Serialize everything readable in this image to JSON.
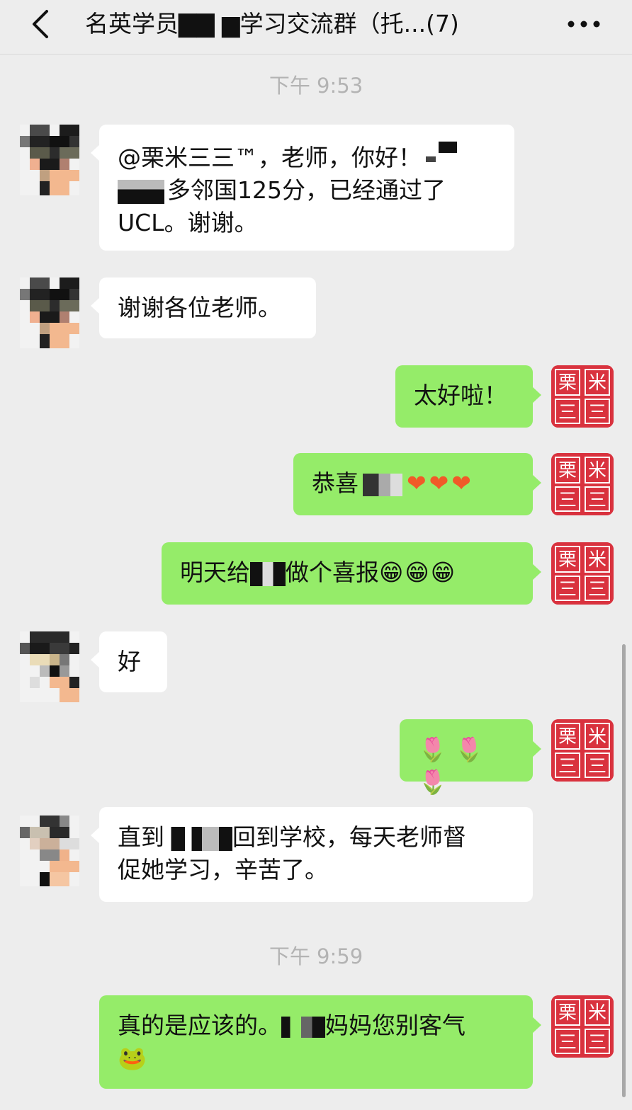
{
  "header": {
    "title": "名英学员▇▇ ▆学习交流群（托...(7)",
    "back_icon": "chevron-left-icon",
    "more_icon": "more-dots-icon"
  },
  "timestamps": [
    "下午 9:53",
    "下午 9:59"
  ],
  "messages": [
    {
      "side": "in",
      "lines": [
        "@栗米三三™，老师，你好！",
        "多邻国125分，已经通过了",
        "UCL。谢谢。"
      ]
    },
    {
      "side": "in",
      "text": "谢谢各位老师。"
    },
    {
      "side": "out",
      "text": "太好啦！"
    },
    {
      "side": "out",
      "text": "恭喜",
      "emoji": "❤❤❤"
    },
    {
      "side": "out",
      "text_a": "明天给",
      "text_b": "做个喜报",
      "emoji": "😁😁😁"
    },
    {
      "side": "in",
      "text": "好"
    },
    {
      "side": "out",
      "emoji": "🌷 🌷 🌷"
    },
    {
      "side": "in",
      "text_a": "直到",
      "text_b": "回到学校，每天老师督",
      "line2": "促她学习，辛苦了。"
    },
    {
      "side": "out",
      "text_a": "真的是应该的。",
      "text_b": "妈妈您别客气",
      "emoji": "🐸"
    }
  ],
  "my_avatar": {
    "chars": [
      "栗",
      "米",
      "三",
      "三"
    ],
    "color": "#d9323e"
  },
  "colors": {
    "outgoing_bubble": "#95ec69",
    "incoming_bubble": "#ffffff",
    "background": "#ededed"
  }
}
